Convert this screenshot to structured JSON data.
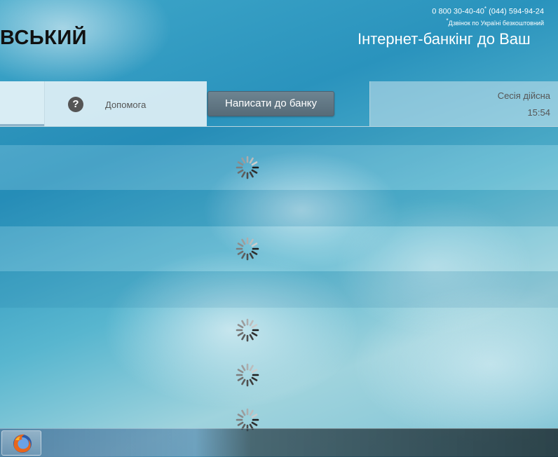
{
  "header": {
    "logo_text": "ВСЬКИЙ",
    "phone_free": "0 800 30-40-40",
    "phone_kyiv": "(044) 594-94-24",
    "free_call_note": "Дзвінок по Україні безкоштовний",
    "slogan": "Інтернет-банкінг до Ваш"
  },
  "toolbar": {
    "help_label": "Допомога",
    "write_bank_label": "Написати до банку",
    "session_status": "Сесія дійсна",
    "session_time": "15:54"
  },
  "content": {
    "loading_blocks": 5
  },
  "taskbar": {
    "pinned": [
      "firefox-icon"
    ]
  }
}
